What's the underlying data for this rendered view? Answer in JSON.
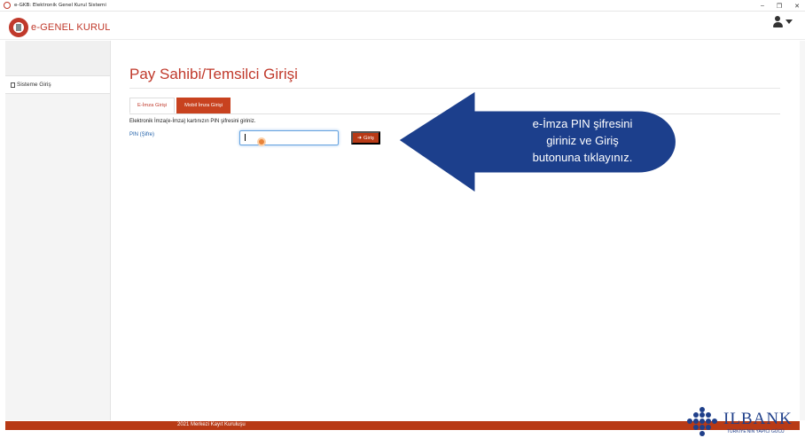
{
  "window": {
    "title": "e-GKB: Elektronik Genel Kurul Sistemi",
    "min": "–",
    "restore": "❐",
    "close": "✕"
  },
  "header": {
    "logo_text": "e-GENEL KURUL"
  },
  "sidebar": {
    "items": [
      {
        "label": "Sisteme Giriş"
      }
    ]
  },
  "main": {
    "title": "Pay Sahibi/Temsilci Girişi",
    "tabs": [
      {
        "label": "E-İmza Girişi"
      },
      {
        "label": "Mobil İmza Girişi"
      }
    ],
    "instruction": "Elektronik İmza(e-İmza) kartınızın PIN şifresini giriniz.",
    "pin_label": "PIN (Şifre)",
    "pin_value": "",
    "login_button": "Giriş"
  },
  "overlay": {
    "lines": [
      "e-İmza PIN şifresini",
      "giriniz ve Giriş",
      "butonuna tıklayınız."
    ],
    "color": "#1c3f8c"
  },
  "footer": {
    "text": "2021 Merkezi Kayıt Kuruluşu"
  },
  "watermark": {
    "name": "ILBANK",
    "tagline": "TÜRKİYE'NİN YAPICI GÜCÜ"
  },
  "colors": {
    "accent": "#c0392b",
    "button": "#b83a16",
    "link": "#1f5fa8"
  }
}
